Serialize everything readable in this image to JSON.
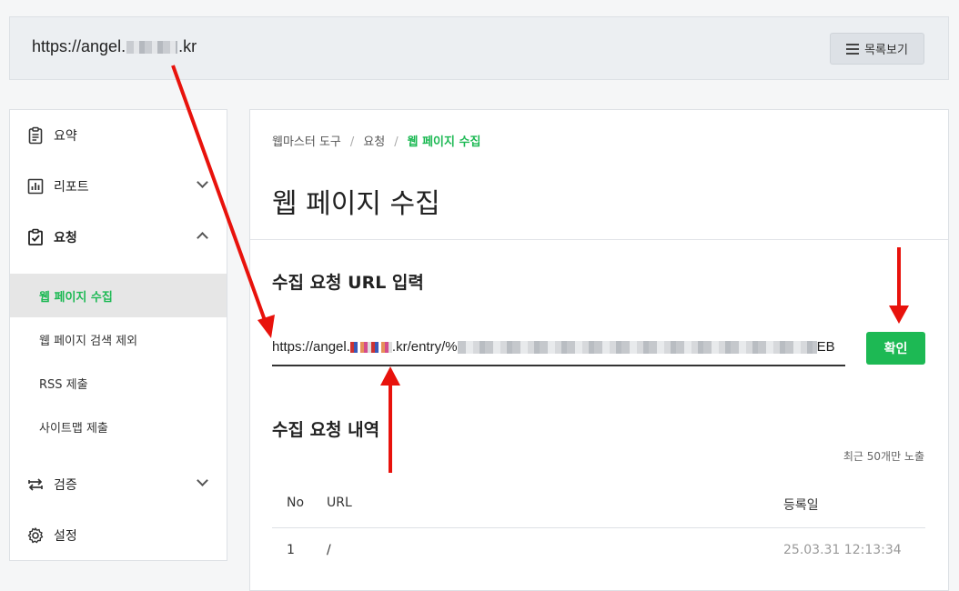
{
  "header": {
    "site_url_prefix": "https://angel.",
    "site_url_suffix": ".kr",
    "list_button": "목록보기"
  },
  "sidebar": {
    "summary": "요약",
    "report": "리포트",
    "request": "요청",
    "sub_items": [
      "웹 페이지 수집",
      "웹 페이지 검색 제외",
      "RSS 제출",
      "사이트맵 제출"
    ],
    "verify": "검증",
    "settings": "설정"
  },
  "main": {
    "breadcrumb": [
      "웹마스터 도구",
      "요청",
      "웹 페이지 수집"
    ],
    "breadcrumb_sep": "/",
    "title": "웹 페이지 수집",
    "input_section_title": "수집 요청 URL 입력",
    "url_value_prefix": "https://angel.",
    "url_value_mid": ".kr/entry/%",
    "url_value_end": "EB",
    "confirm_button": "확인",
    "history_title": "수집 요청 내역",
    "limit_note": "최근 50개만 노출",
    "table": {
      "columns": [
        "No",
        "URL",
        "등록일"
      ],
      "rows": [
        {
          "no": "1",
          "url": "/",
          "date": "25.03.31 12:13:34"
        }
      ]
    }
  },
  "colors": {
    "accent": "#1db954",
    "annotation_arrow": "#e8120c"
  },
  "icons": [
    "clipboard-icon",
    "bar-chart-icon",
    "clipboard-check-icon",
    "swap-icon",
    "gear-icon",
    "list-icon",
    "chevron-down-icon",
    "chevron-up-icon"
  ]
}
